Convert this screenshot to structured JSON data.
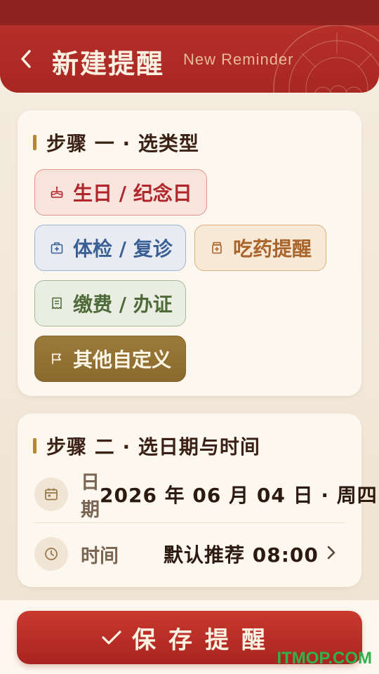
{
  "header": {
    "title_cn": "新建提醒",
    "title_en": "New Reminder",
    "back_icon": "chevron-left-icon"
  },
  "step1": {
    "title": "步骤 一 · 选类型",
    "types": [
      {
        "label": "生日 / 纪念日",
        "icon": "cake-icon",
        "color": "#b0262a"
      },
      {
        "label": "体检 / 复诊",
        "icon": "medical-kit-icon",
        "color": "#3a5f95"
      },
      {
        "label": "吃药提醒",
        "icon": "pill-bottle-icon",
        "color": "#a9652b"
      },
      {
        "label": "缴费 / 办证",
        "icon": "receipt-icon",
        "color": "#4e6a3a"
      },
      {
        "label": "其他自定义",
        "icon": "flag-icon",
        "color": "#8a6a2d",
        "selected": true
      }
    ]
  },
  "step2": {
    "title": "步骤 二 · 选日期与时间",
    "date_label": "日期",
    "date_value": "2026 年 06 月 04 日 · 周四",
    "time_label": "时间",
    "time_value": "默认推荐 08:00"
  },
  "save_button": {
    "label": "保存提醒",
    "icon": "check-icon"
  },
  "watermark": "ITMOP.COM",
  "colors": {
    "primary": "#b62f29",
    "background": "#f6ece0",
    "card": "#fdf8ef",
    "accent_gold": "#b8862f"
  }
}
